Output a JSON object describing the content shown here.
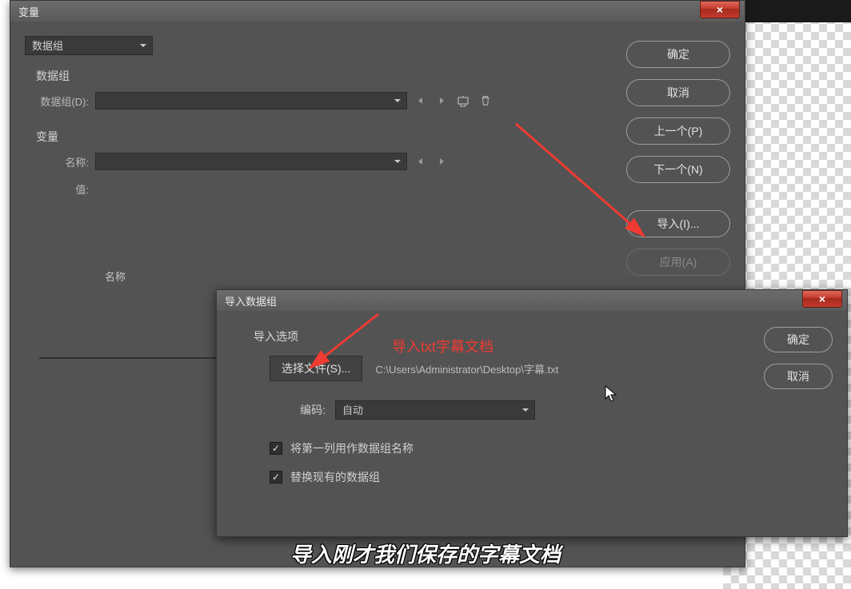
{
  "main_dialog": {
    "title": "变量",
    "selector_label": "数据组",
    "section_datagroup": "数据组",
    "datagroup_row_label": "数据组(D):",
    "datagroup_value": "",
    "section_variable": "变量",
    "name_label": "名称:",
    "name_value": "",
    "value_label": "值:",
    "list_header": "名称",
    "buttons": {
      "ok": "确定",
      "cancel": "取消",
      "prev": "上一个(P)",
      "next": "下一个(N)",
      "import": "导入(I)...",
      "apply": "应用(A)"
    }
  },
  "sub_dialog": {
    "title": "导入数据组",
    "section": "导入选项",
    "select_file_btn": "选择文件(S)...",
    "file_path": "C:\\Users\\Administrator\\Desktop\\字幕.txt",
    "encode_label": "编码:",
    "encode_value": "自动",
    "cb1": "将第一列用作数据组名称",
    "cb2": "替换现有的数据组",
    "buttons": {
      "ok": "确定",
      "cancel": "取消"
    }
  },
  "annotation": {
    "red_text": "导入txt字幕文档",
    "caption": "导入刚才我们保存的字幕文档"
  },
  "icons": {
    "close": "×",
    "check": "✓"
  }
}
